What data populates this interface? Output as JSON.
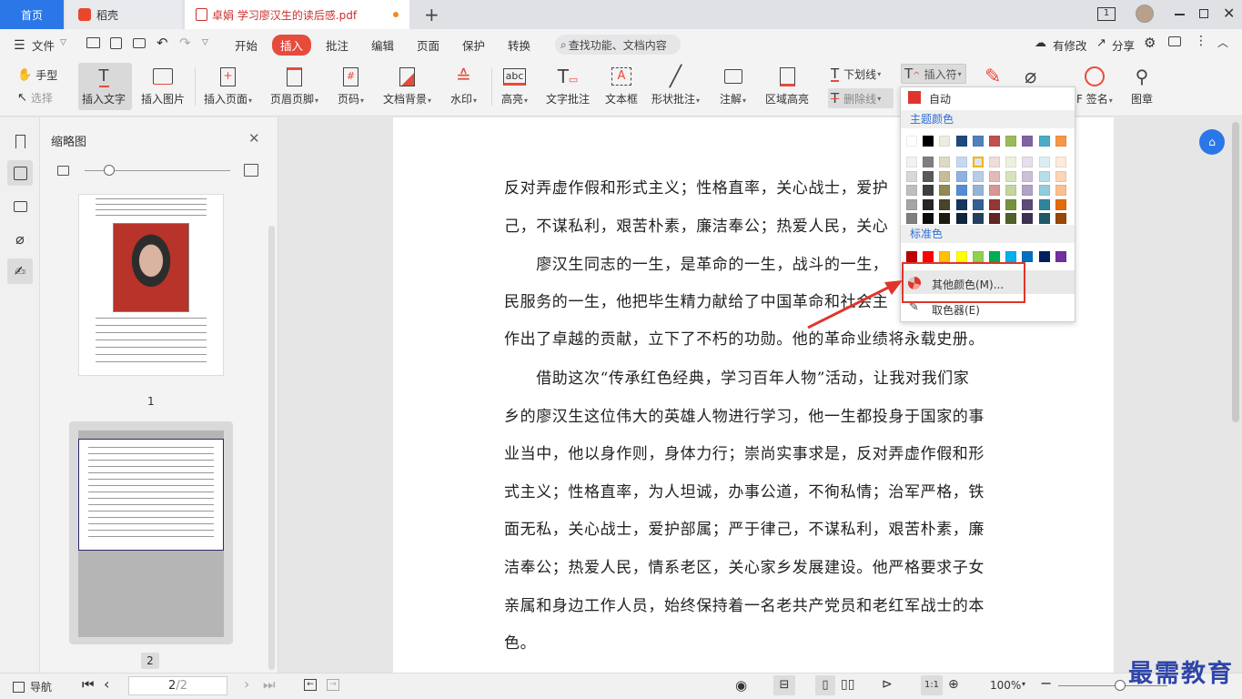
{
  "tabs": {
    "home": "首页",
    "daoke": "稻壳",
    "doc": "卓娟 学习廖汉生的读后感.pdf"
  },
  "window": {
    "page_badge": "1"
  },
  "menu": {
    "file": "文件",
    "items": [
      "开始",
      "插入",
      "批注",
      "编辑",
      "页面",
      "保护",
      "转换"
    ],
    "search": "查找功能、文档内容",
    "modified": "有修改",
    "share": "分享"
  },
  "toolbar": {
    "hand": "手型",
    "select": "选择",
    "insert_text": "插入文字",
    "insert_image": "插入图片",
    "insert_page": "插入页面",
    "header_footer": "页眉页脚",
    "page_number": "页码",
    "doc_bg": "文档背景",
    "watermark": "水印",
    "highlight": "高亮",
    "text_annot": "文字批注",
    "textbox": "文本框",
    "shape_annot": "形状批注",
    "note": "注解",
    "area_highlight": "区域高亮",
    "underline": "下划线",
    "strikethrough": "删除线",
    "insert_mark": "插入符",
    "sign": "F 签名",
    "stamp": "图章"
  },
  "sidebar": {
    "title": "缩略图",
    "page1_label": "1",
    "page2_label": "2"
  },
  "document": {
    "lines": [
      "反对弄虚作假和形式主义；性格直率，关心战士，爱护",
      "己，不谋私利，艰苦朴素，廉洁奉公；热爱人民，关心",
      "　　廖汉生同志的一生，是革命的一生，战斗的一生，",
      "民服务的一生，他把毕生精力献给了中国革命和社会主",
      "作出了卓越的贡献，立下了不朽的功勋。他的革命业绩将永载史册。",
      "　　借助这次“传承红色经典，学习百年人物”活动，让我对我们家",
      "乡的廖汉生这位伟大的英雄人物进行学习，他一生都投身于国家的事",
      "业当中，他以身作则，身体力行；崇尚实事求是，反对弄虚作假和形",
      "式主义；性格直率，为人坦诚，办事公道，不徇私情；治军严格，铁",
      "面无私，关心战士，爱护部属；严于律己，不谋私利，艰苦朴素，廉",
      "洁奉公；热爱人民，情系老区，关心家乡发展建设。他严格要求子女",
      "亲属和身边工作人员，始终保持着一名老共产党员和老红军战士的本",
      "色。"
    ]
  },
  "dropdown": {
    "auto": "自动",
    "theme_colors": "主题颜色",
    "standard_colors": "标准色",
    "more_colors": "其他颜色(M)...",
    "eyedropper": "取色器(E)",
    "theme_top": [
      "#ffffff",
      "#000000",
      "#eeece1",
      "#1f497d",
      "#4f81bd",
      "#c0504d",
      "#9bbb59",
      "#8064a2",
      "#4bacc6",
      "#f79646"
    ],
    "theme_shades": [
      [
        "#f2f2f2",
        "#7f7f7f",
        "#ddd9c3",
        "#c6d9f0",
        "#dbe5f1",
        "#f2dcdb",
        "#ebf1dd",
        "#e5e0ec",
        "#dbeef3",
        "#fdeada"
      ],
      [
        "#d8d8d8",
        "#595959",
        "#c4bd97",
        "#8db3e2",
        "#b8cce4",
        "#e5b9b7",
        "#d7e3bc",
        "#ccc1d9",
        "#b7dde8",
        "#fbd5b5"
      ],
      [
        "#bfbfbf",
        "#3f3f3f",
        "#938953",
        "#548dd4",
        "#95b3d7",
        "#d99694",
        "#c3d69b",
        "#b2a2c7",
        "#92cddc",
        "#fac08f"
      ],
      [
        "#a5a5a5",
        "#262626",
        "#494429",
        "#17365d",
        "#366092",
        "#953734",
        "#76923c",
        "#5f497a",
        "#31859b",
        "#e36c09"
      ],
      [
        "#7f7f7f",
        "#0c0c0c",
        "#1d1b10",
        "#0f243e",
        "#244061",
        "#632423",
        "#4f6128",
        "#3f3151",
        "#205867",
        "#974806"
      ]
    ],
    "standard": [
      "#c00000",
      "#ff0000",
      "#ffc000",
      "#ffff00",
      "#92d050",
      "#00b050",
      "#00b0f0",
      "#0070c0",
      "#002060",
      "#7030a0"
    ],
    "auto_color": "#e0352b"
  },
  "status": {
    "nav": "导航",
    "page_input": "2",
    "page_total": "/2",
    "zoom": "100%"
  },
  "watermark": "最需教育",
  "colors": {
    "accent": "#2b77e8",
    "insert_tab": "#e64b3c",
    "callout": "#e0352b"
  }
}
